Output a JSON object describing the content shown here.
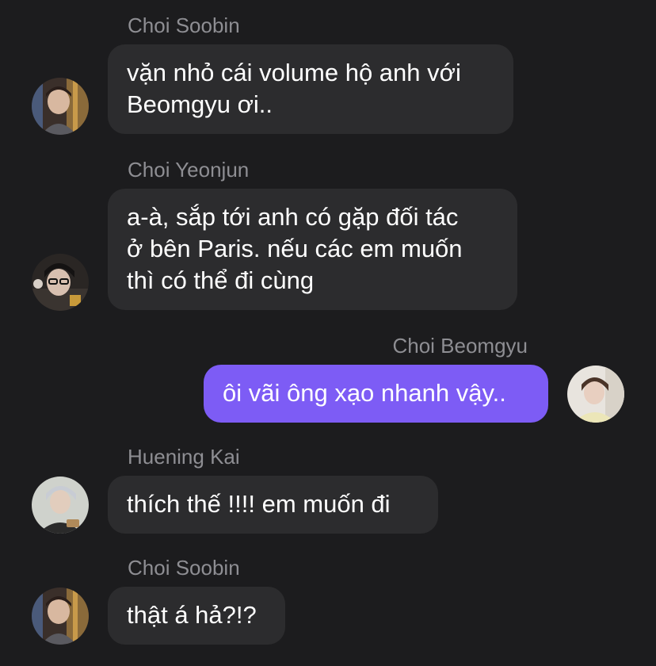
{
  "messages": [
    {
      "sender": "Choi Soobin",
      "lines": [
        "vặn nhỏ cái volume hộ anh với",
        "Beomgyu ơi.."
      ],
      "outgoing": false,
      "avatar": "avatar-photo-soobin"
    },
    {
      "sender": "Choi Yeonjun",
      "lines": [
        "a-à, sắp tới anh có gặp đối tác",
        "ở bên Paris. nếu các em muốn",
        "thì có thể đi cùng"
      ],
      "outgoing": false,
      "avatar": "avatar-photo-yeonjun"
    },
    {
      "sender": "Choi Beomgyu",
      "lines": [
        "ôi vãi ông xạo nhanh vậy.."
      ],
      "outgoing": true,
      "avatar": "avatar-photo-beomgyu"
    },
    {
      "sender": "Huening Kai",
      "lines": [
        "thích thế !!!! em muốn đi"
      ],
      "outgoing": false,
      "avatar": "avatar-photo-hueningkai"
    },
    {
      "sender": "Choi Soobin",
      "lines": [
        "thật á hả?!?"
      ],
      "outgoing": false,
      "avatar": "avatar-photo-soobin"
    }
  ],
  "colors": {
    "background": "#1c1c1e",
    "incoming_bubble": "#2c2c2e",
    "outgoing_bubble": "#7d5cf5",
    "sender_name": "#8e8e93",
    "message_text": "#ffffff"
  }
}
